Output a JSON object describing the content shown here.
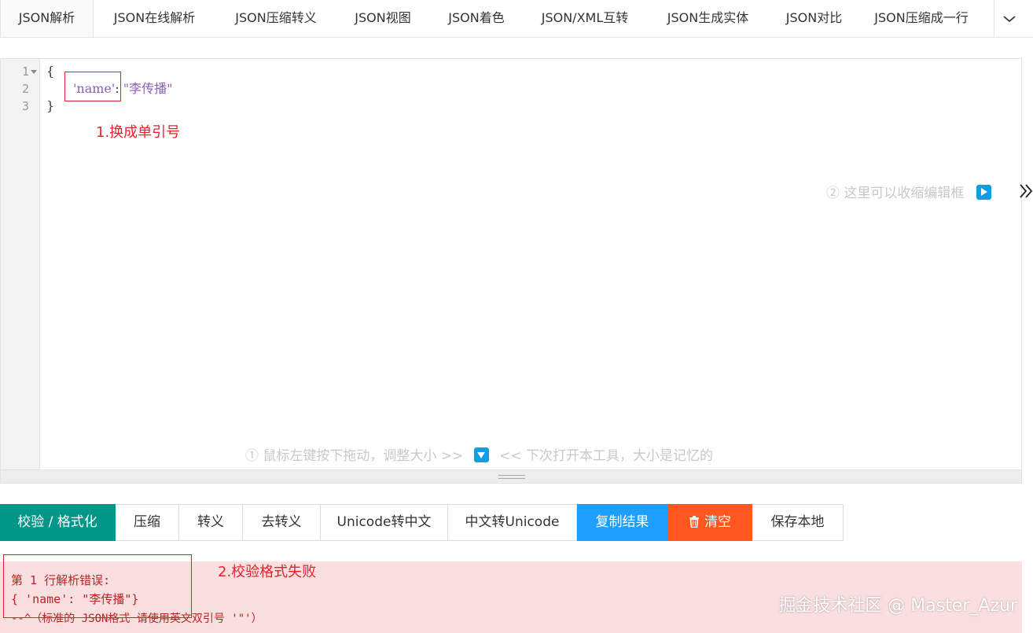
{
  "tabs": [
    {
      "label": "JSON解析"
    },
    {
      "label": "JSON在线解析"
    },
    {
      "label": "JSON压缩转义"
    },
    {
      "label": "JSON视图"
    },
    {
      "label": "JSON着色"
    },
    {
      "label": "JSON/XML互转"
    },
    {
      "label": "JSON生成实体"
    },
    {
      "label": "JSON对比"
    },
    {
      "label": "JSON压缩成一行"
    }
  ],
  "editor": {
    "line_numbers": [
      "1",
      "2",
      "3"
    ],
    "line1": "{",
    "line2_key": "'name'",
    "line2_colon": ": ",
    "line2_value": "\"李传播\"",
    "line3": "}",
    "hint_collapse": "② 这里可以收缩编辑框",
    "hint_resize_left": "① 鼠标左键按下拖动，调整大小 >>",
    "hint_resize_right": "<< 下次打开本工具，大小是记忆的"
  },
  "annotations": {
    "note1": "1.换成单引号",
    "note2": "2.校验格式失败"
  },
  "toolbar": {
    "validate": "校验 / 格式化",
    "compress": "压缩",
    "escape": "转义",
    "unescape": "去转义",
    "unicode_to_cn": "Unicode转中文",
    "cn_to_unicode": "中文转Unicode",
    "copy": "复制结果",
    "clear": "清空",
    "save": "保存本地"
  },
  "error": {
    "line1": "第 1 行解析错误:",
    "line2": "{ 'name': \"李传播\"}",
    "line3": "--^（标准的 JSON格式 请使用英文双引号 '\"'）"
  },
  "watermark": "掘金技术社区 @ Master_Azur",
  "colors": {
    "primary": "#009688",
    "blue": "#1e9fff",
    "orange": "#ff5722",
    "error_bg": "#f9dfe0",
    "annotation": "#e3232c"
  }
}
